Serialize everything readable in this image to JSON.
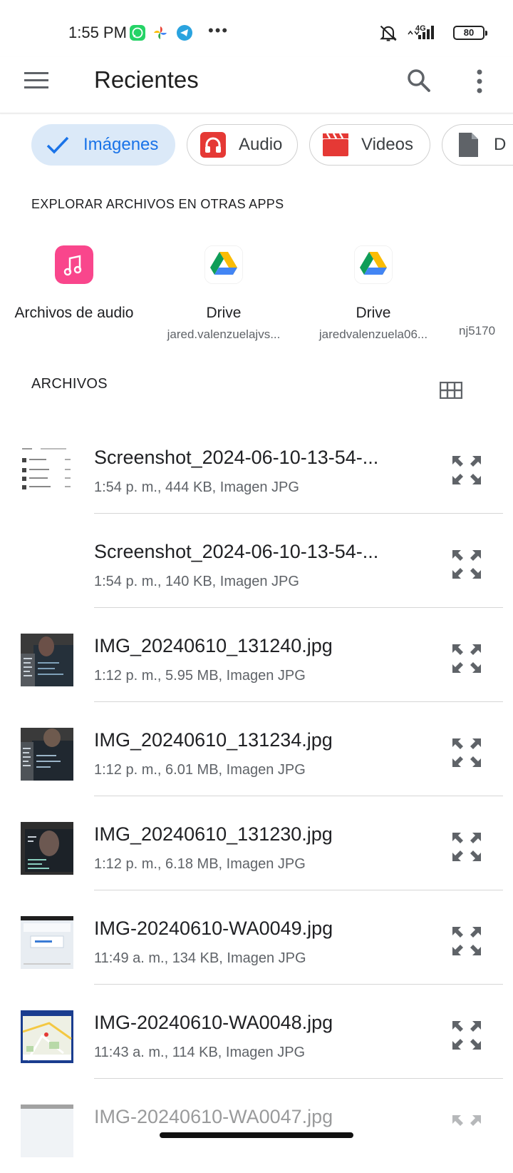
{
  "status_bar": {
    "time": "1:55 PM",
    "network": "4G",
    "battery": "80",
    "more": "•••"
  },
  "app_bar": {
    "title": "Recientes"
  },
  "filter_chips": [
    {
      "label": "Imágenes",
      "icon": "check-icon",
      "selected": true
    },
    {
      "label": "Audio",
      "icon": "headphones-icon",
      "selected": false
    },
    {
      "label": "Videos",
      "icon": "clapperboard-icon",
      "selected": false
    },
    {
      "label": "D",
      "icon": "document-icon",
      "selected": false
    }
  ],
  "explore_section": {
    "title": "EXPLORAR ARCHIVOS EN OTRAS APPS",
    "apps": [
      {
        "name": "Archivos de audio",
        "subtitle": "",
        "icon": "audio-files-icon"
      },
      {
        "name": "Drive",
        "subtitle": "jared.valenzuelajvs...",
        "icon": "google-drive-icon"
      },
      {
        "name": "Drive",
        "subtitle": "jaredvalenzuela06...",
        "icon": "google-drive-icon"
      },
      {
        "name": "",
        "subtitle": "nj5170",
        "icon": ""
      }
    ]
  },
  "files_section": {
    "title": "ARCHIVOS",
    "files": [
      {
        "name": "Screenshot_2024-06-10-13-54-...",
        "meta": "1:54 p. m., 444 KB, Imagen JPG",
        "thumb": "screenshot"
      },
      {
        "name": "Screenshot_2024-06-10-13-54-...",
        "meta": "1:54 p. m., 140 KB, Imagen JPG",
        "thumb": "blank"
      },
      {
        "name": "IMG_20240610_131240.jpg",
        "meta": "1:12 p. m., 5.95 MB, Imagen JPG",
        "thumb": "photo"
      },
      {
        "name": "IMG_20240610_131234.jpg",
        "meta": "1:12 p. m., 6.01 MB, Imagen JPG",
        "thumb": "photo"
      },
      {
        "name": "IMG_20240610_131230.jpg",
        "meta": "1:12 p. m., 6.18 MB, Imagen JPG",
        "thumb": "photo"
      },
      {
        "name": "IMG-20240610-WA0049.jpg",
        "meta": "11:49 a. m., 134 KB, Imagen JPG",
        "thumb": "web"
      },
      {
        "name": "IMG-20240610-WA0048.jpg",
        "meta": "11:43 a. m., 114 KB, Imagen JPG",
        "thumb": "map"
      },
      {
        "name": "IMG-20240610-WA0047.jpg",
        "meta": "",
        "thumb": "web"
      }
    ]
  },
  "colors": {
    "accent": "#1a73e8",
    "chip_selected_bg": "#dbe9f8",
    "audio_red": "#e53935",
    "audio_app_pink": "#f9468c"
  }
}
